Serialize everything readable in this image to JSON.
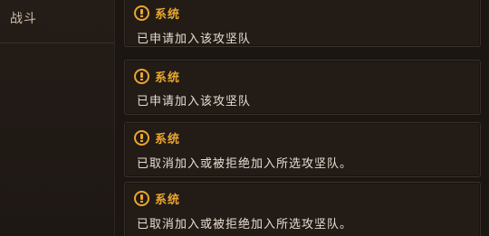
{
  "sidebar": {
    "tab_label": "战斗"
  },
  "messages": [
    {
      "title": "系统",
      "text": "已申请加入该攻坚队"
    },
    {
      "title": "系统",
      "text": "已申请加入该攻坚队"
    },
    {
      "title": "系统",
      "text": "已取消加入或被拒绝加入所选攻坚队。"
    },
    {
      "title": "系统",
      "text": "已取消加入或被拒绝加入所选攻坚队。"
    }
  ],
  "colors": {
    "accent": "#e8a630",
    "text": "#e6ddd2",
    "background": "#1c1612"
  },
  "icons": {
    "message": "exclamation-circle-icon"
  }
}
